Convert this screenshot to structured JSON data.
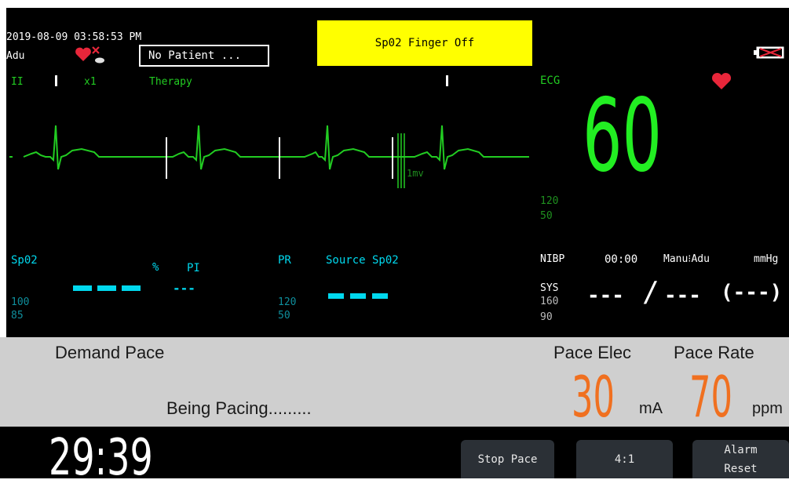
{
  "header": {
    "datetime": "2019-08-09 03:58:53 PM",
    "patient_type": "Adu",
    "patient_box": "No Patient ...",
    "alarm_message": "Sp02  Finger Off"
  },
  "ecg_wave": {
    "lead": "II",
    "gain": "x1",
    "mode": "Therapy",
    "calibration": "1mv"
  },
  "ecg_param": {
    "label": "ECG",
    "heart_rate": "60",
    "limit_high": "120",
    "limit_low": "50"
  },
  "spo2": {
    "label": "Sp02",
    "unit": "%",
    "pi_label": "PI",
    "pi_value": "---",
    "limit_high": "100",
    "limit_low": "85"
  },
  "pr": {
    "label": "PR",
    "source": "Source Sp02",
    "limit_high": "120",
    "limit_low": "50"
  },
  "nibp": {
    "label": "NIBP",
    "time": "00:00",
    "mode": "Manu⁝Adu",
    "unit": "mmHg",
    "sys_label": "SYS",
    "sys_high": "160",
    "sys_low": "90",
    "value_sys": "---",
    "separator": "/",
    "value_dia": "---",
    "value_mean": "(---)"
  },
  "pace": {
    "title": "Demand Pace",
    "status": "Being Pacing.........",
    "elec_label": "Pace Elec",
    "elec_value": "30",
    "elec_unit": "mA",
    "rate_label": "Pace Rate",
    "rate_value": "70",
    "rate_unit": "ppm"
  },
  "footer": {
    "timer": "29:39",
    "buttons": [
      {
        "label": "Stop Pace"
      },
      {
        "label": "4:1"
      },
      {
        "label_line1": "Alarm",
        "label_line2": "Reset"
      }
    ]
  },
  "colors": {
    "ecg": "#22cc22",
    "spo2": "#00d8ee",
    "pace": "#f07020",
    "alarm_bg": "#ffff00"
  }
}
